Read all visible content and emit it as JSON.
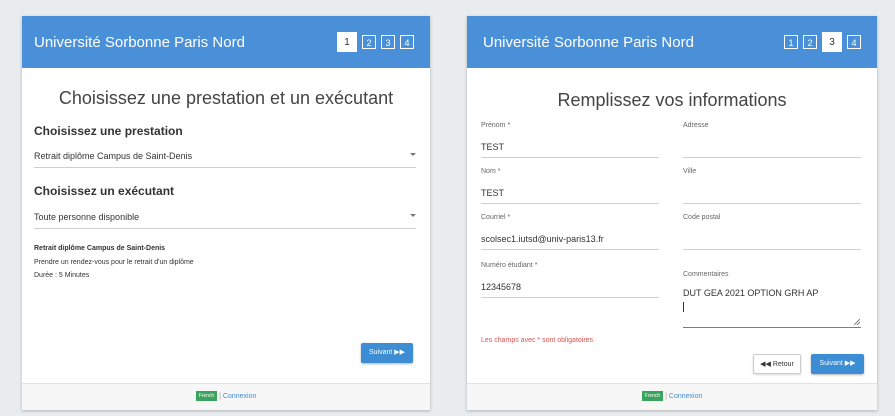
{
  "left": {
    "header": {
      "title": "Université Sorbonne Paris Nord",
      "steps": [
        "1",
        "2",
        "3",
        "4"
      ],
      "active_step": 1
    },
    "heading": "Choisissez une prestation et un exécutant",
    "service_section": "Choisissez une prestation",
    "service_value": "Retrait diplôme Campus de Saint-Denis",
    "executor_section": "Choisissez un exécutant",
    "executor_value": "Toute personne disponible",
    "description": {
      "title": "Retrait diplôme Campus de Saint-Denis",
      "text": "Prendre un rendez-vous pour le retrait d'un diplôme",
      "duration": "Durée : 5 Minutes"
    },
    "next_button": "Suivant",
    "footer": {
      "language": "French",
      "separator": "|",
      "login": "Connexion"
    }
  },
  "right": {
    "header": {
      "title": "Université Sorbonne Paris Nord",
      "steps": [
        "1",
        "2",
        "3",
        "4"
      ],
      "active_step": 3
    },
    "heading": "Remplissez vos informations",
    "fields": {
      "prenom": {
        "label": "Prénom *",
        "value": "TEST"
      },
      "nom": {
        "label": "Nom *",
        "value": "TEST"
      },
      "courriel": {
        "label": "Courriel *",
        "value": "scolsec1.iutsd@univ-paris13.fr"
      },
      "numero": {
        "label": "Numéro étudiant *",
        "value": "12345678"
      },
      "adresse": {
        "label": "Adresse",
        "value": ""
      },
      "ville": {
        "label": "Ville",
        "value": ""
      },
      "code_postal": {
        "label": "Code postal",
        "value": ""
      },
      "commentaires": {
        "label": "Commentaires",
        "value": "DUT GEA 2021 OPTION GRH AP"
      }
    },
    "required_note": "Les champs avec * sont obligatoires",
    "back_button": "Retour",
    "next_button": "Suivant",
    "footer": {
      "language": "French",
      "separator": "|",
      "login": "Connexion"
    }
  },
  "colors": {
    "header": "#4a90d9",
    "primary_button": "#3c8dd3",
    "required": "#d9534f",
    "language_badge": "#3aa35d"
  }
}
